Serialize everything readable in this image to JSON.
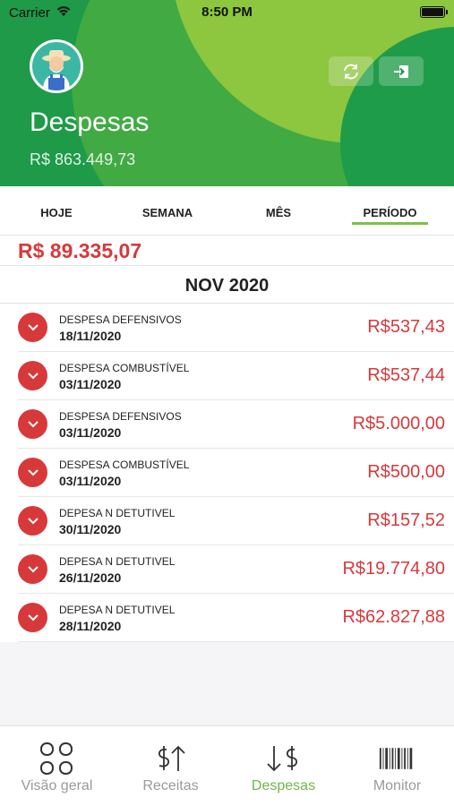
{
  "status_bar": {
    "carrier": "Carrier",
    "time": "8:50 PM"
  },
  "header": {
    "title": "Despesas",
    "total": "R$ 863.449,73"
  },
  "tabs": [
    {
      "label": "HOJE"
    },
    {
      "label": "SEMANA"
    },
    {
      "label": "MÊS"
    },
    {
      "label": "PERÍODO",
      "active": true
    }
  ],
  "period_total": "R$ 89.335,07",
  "month": "NOV 2020",
  "expenses": [
    {
      "name": "DESPESA DEFENSIVOS",
      "date": "18/11/2020",
      "amount": "R$537,43"
    },
    {
      "name": "DESPESA COMBUSTÍVEL",
      "date": "03/11/2020",
      "amount": "R$537,44"
    },
    {
      "name": "DESPESA DEFENSIVOS",
      "date": "03/11/2020",
      "amount": "R$5.000,00"
    },
    {
      "name": "DESPESA COMBUSTÍVEL",
      "date": "03/11/2020",
      "amount": "R$500,00"
    },
    {
      "name": "DEPESA N DETUTIVEL",
      "date": "30/11/2020",
      "amount": "R$157,52"
    },
    {
      "name": "DEPESA N DETUTIVEL",
      "date": "26/11/2020",
      "amount": "R$19.774,80"
    },
    {
      "name": "DEPESA N DETUTIVEL",
      "date": "28/11/2020",
      "amount": "R$62.827,88"
    }
  ],
  "nav": [
    {
      "label": "Visão geral",
      "icon": "grid-icon"
    },
    {
      "label": "Receitas",
      "icon": "income-icon"
    },
    {
      "label": "Despesas",
      "icon": "expense-icon",
      "active": true
    },
    {
      "label": "Monitor",
      "icon": "barcode-icon"
    }
  ],
  "colors": {
    "header_green": "#1e9a48",
    "light_green": "#8dc63f",
    "accent_green": "#6cb84a",
    "expense_red": "#d7393b"
  }
}
